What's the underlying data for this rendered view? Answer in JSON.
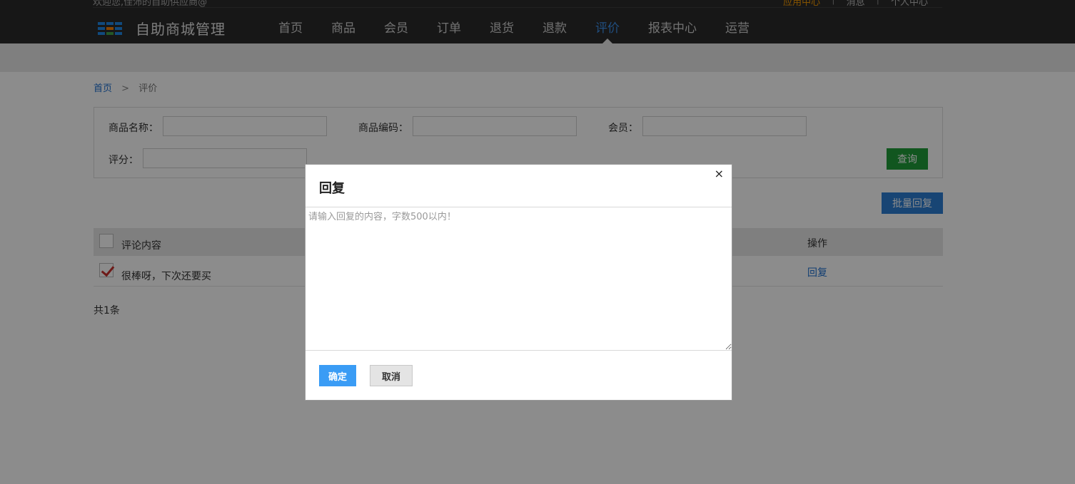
{
  "header": {
    "welcome": "欢迎您,佳沛的自助供应商@",
    "top_links": [
      "应用中心",
      "消息",
      "个人中心"
    ],
    "app_title": "自助商城管理",
    "nav": [
      "首页",
      "商品",
      "会员",
      "订单",
      "退货",
      "退款",
      "评价",
      "报表中心",
      "运营"
    ],
    "active_nav": "评价",
    "accent_color": "#3b8ee8",
    "logo_icon": "grid-logo-icon"
  },
  "breadcrumb": {
    "home": "首页",
    "separator": ">",
    "current": "评价"
  },
  "filter": {
    "product_name_label": "商品名称：",
    "product_name_value": "",
    "product_code_label": "商品编码：",
    "product_code_value": "",
    "member_label": "会员：",
    "member_value": "",
    "rating_label": "评分：",
    "rating_value": "",
    "query_button": "查询"
  },
  "batch_reply_button": "批量回复",
  "table": {
    "columns": [
      "评论内容",
      "操作"
    ],
    "rows": [
      {
        "checked": true,
        "content": "很棒呀，下次还要买",
        "action": "回复"
      }
    ]
  },
  "total": "共1条",
  "modal": {
    "title": "回复",
    "close_icon": "close-icon",
    "close_glyph": "×",
    "textarea_value": "",
    "textarea_placeholder": "请输入回复的内容，字数500以内！",
    "ok_button": "确定",
    "cancel_button": "取消"
  }
}
